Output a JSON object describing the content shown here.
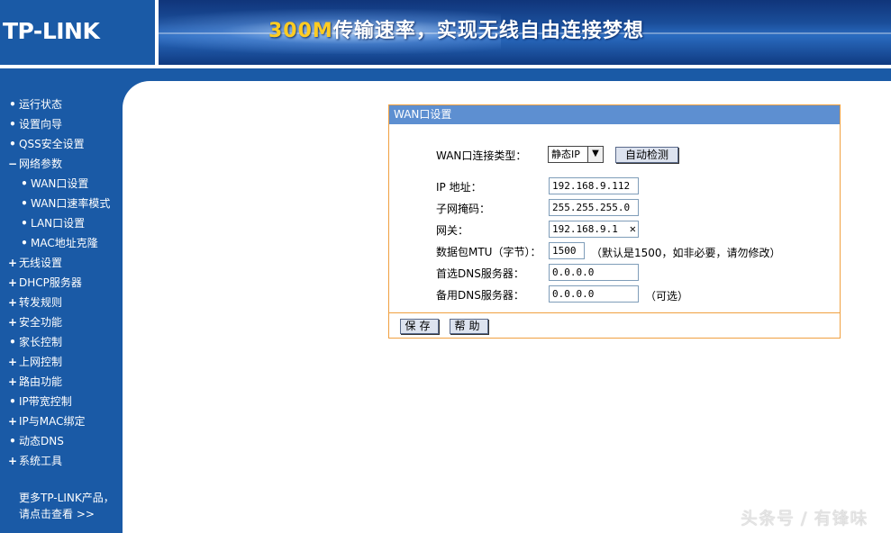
{
  "header": {
    "logo": "TP-LINK",
    "slogan_highlight": "300M",
    "slogan_rest": "传输速率，实现无线自由连接梦想"
  },
  "sidebar": {
    "items": [
      {
        "label": "运行状态",
        "bullet": "•",
        "level": "top"
      },
      {
        "label": "设置向导",
        "bullet": "•",
        "level": "top"
      },
      {
        "label": "QSS安全设置",
        "bullet": "•",
        "level": "top"
      },
      {
        "label": "网络参数",
        "bullet": "−",
        "level": "top"
      },
      {
        "label": "WAN口设置",
        "bullet": "•",
        "level": "sub"
      },
      {
        "label": "WAN口速率模式",
        "bullet": "•",
        "level": "sub"
      },
      {
        "label": "LAN口设置",
        "bullet": "•",
        "level": "sub"
      },
      {
        "label": "MAC地址克隆",
        "bullet": "•",
        "level": "sub"
      },
      {
        "label": "无线设置",
        "bullet": "+",
        "level": "top"
      },
      {
        "label": "DHCP服务器",
        "bullet": "+",
        "level": "top"
      },
      {
        "label": "转发规则",
        "bullet": "+",
        "level": "top"
      },
      {
        "label": "安全功能",
        "bullet": "+",
        "level": "top"
      },
      {
        "label": "家长控制",
        "bullet": "•",
        "level": "top"
      },
      {
        "label": "上网控制",
        "bullet": "+",
        "level": "top"
      },
      {
        "label": "路由功能",
        "bullet": "+",
        "level": "top"
      },
      {
        "label": "IP带宽控制",
        "bullet": "•",
        "level": "top"
      },
      {
        "label": "IP与MAC绑定",
        "bullet": "+",
        "level": "top"
      },
      {
        "label": "动态DNS",
        "bullet": "•",
        "level": "top"
      },
      {
        "label": "系统工具",
        "bullet": "+",
        "level": "top"
      }
    ],
    "more_line1": "更多TP-LINK产品，",
    "more_line2": "请点击查看 >>"
  },
  "panel": {
    "title": "WAN口设置",
    "wan_type_label": "WAN口连接类型：",
    "wan_type_value": "静态IP",
    "auto_detect": "自动检测",
    "ip_label": "IP 地址：",
    "ip_value": "192.168.9.112",
    "mask_label": "子网掩码：",
    "mask_value": "255.255.255.0",
    "gateway_label": "网关：",
    "gateway_value": "192.168.9.1",
    "mtu_label": "数据包MTU（字节）：",
    "mtu_value": "1500",
    "mtu_note": "（默认是1500，如非必要，请勿修改）",
    "dns1_label": "首选DNS服务器：",
    "dns1_value": "0.0.0.0",
    "dns2_label": "备用DNS服务器：",
    "dns2_value": "0.0.0.0",
    "dns2_note": "（可选）",
    "save_label": "保存",
    "help_label": "帮助"
  },
  "watermark": "头条号 / 有锋味",
  "colors": {
    "brand_blue": "#1a5aa6",
    "panel_title_bg": "#5d8fd1",
    "panel_border": "#f0a040"
  }
}
